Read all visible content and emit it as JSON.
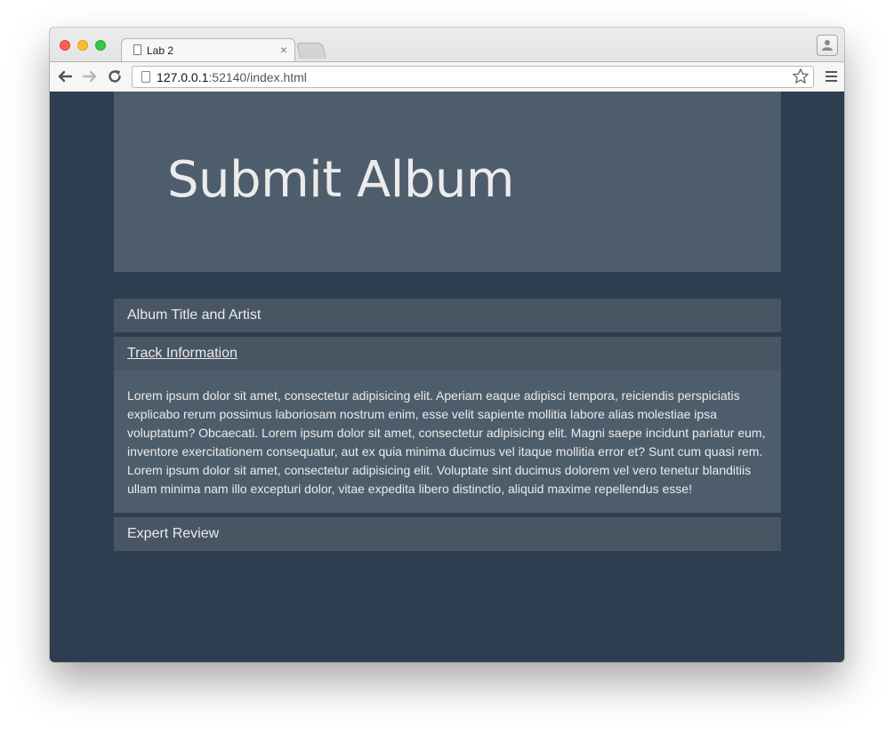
{
  "browser": {
    "tab_title": "Lab 2",
    "tab_close": "×",
    "url_host": "127.0.0.1",
    "url_rest": ":52140/index.html"
  },
  "icons": {
    "back": "back-arrow-icon",
    "forward": "forward-arrow-icon",
    "reload": "reload-icon",
    "star": "bookmark-star-icon",
    "menu": "hamburger-menu-icon",
    "profile": "profile-icon",
    "document": "document-icon"
  },
  "colors": {
    "page_background": "#2c3e50",
    "panel_background": "#4e5d6c",
    "panel_heading": "#485563",
    "text": "#ebebeb"
  },
  "page": {
    "title": "Submit Album",
    "panels": [
      {
        "heading": "Album Title and Artist",
        "expanded": false
      },
      {
        "heading": "Track Information",
        "expanded": true,
        "body": "Lorem ipsum dolor sit amet, consectetur adipisicing elit. Aperiam eaque adipisci tempora, reiciendis perspiciatis explicabo rerum possimus laboriosam nostrum enim, esse velit sapiente mollitia labore alias molestiae ipsa voluptatum? Obcaecati. Lorem ipsum dolor sit amet, consectetur adipisicing elit. Magni saepe incidunt pariatur eum, inventore exercitationem consequatur, aut ex quia minima ducimus vel itaque mollitia error et? Sunt cum quasi rem. Lorem ipsum dolor sit amet, consectetur adipisicing elit. Voluptate sint ducimus dolorem vel vero tenetur blanditiis ullam minima nam illo excepturi dolor, vitae expedita libero distinctio, aliquid maxime repellendus esse!"
      },
      {
        "heading": "Expert Review",
        "expanded": false
      }
    ]
  }
}
